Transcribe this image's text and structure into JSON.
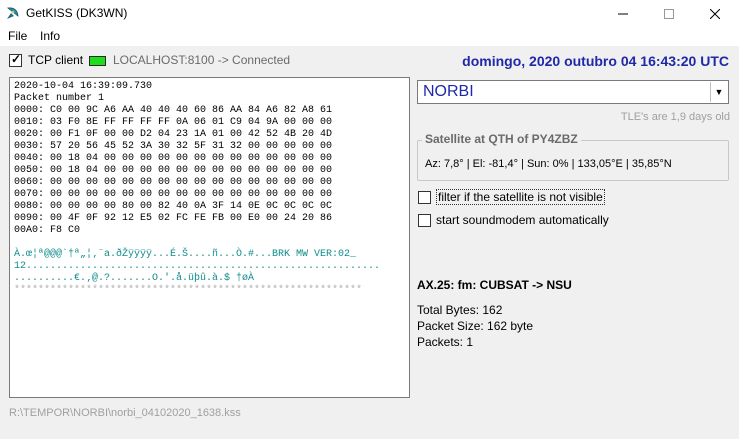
{
  "window": {
    "title": "GetKISS (DK3WN)",
    "icon": "satellite-dish-icon",
    "minimize": "—",
    "maximize": "☐",
    "close": "✕"
  },
  "menu": {
    "file": "File",
    "info": "Info"
  },
  "connection": {
    "tcp_label": "TCP client",
    "tcp_checked": true,
    "status_text": "LOCALHOST:8100 -> Connected",
    "led_color": "#1edc1e"
  },
  "datetime": "domingo, 2020 outubro 04  16:43:20 UTC",
  "hexdump": {
    "header": "2020-10-04 16:39:09.730\nPacket number 1",
    "lines": "0000: C0 00 9C A6 AA 40 40 40 60 86 AA 84 A6 82 A8 61\n0010: 03 F0 8E FF FF FF FF 0A 06 01 C9 04 9A 00 00 00\n0020: 00 F1 0F 00 00 D2 04 23 1A 01 00 42 52 4B 20 4D\n0030: 57 20 56 45 52 3A 30 32 5F 31 32 00 00 00 00 00\n0040: 00 18 04 00 00 00 00 00 00 00 00 00 00 00 00 00\n0050: 00 18 04 00 00 00 00 00 00 00 00 00 00 00 00 00\n0060: 00 00 00 00 00 00 00 00 00 00 00 00 00 00 00 00\n0070: 00 00 00 00 00 00 00 00 00 00 00 00 00 00 00 00\n0080: 00 00 00 00 80 00 82 40 0A 3F 14 0E 0C 0C 0C 0C\n0090: 00 4F 0F 92 12 E5 02 FC FE FB 00 E0 00 24 20 86\n00A0: F8 C0",
    "ascii": "À.œ¦ª@@@`†ª„¦‚¨a.ðŽÿÿÿÿ...É.Š....ñ...Ò.#...BRK MW VER:02_\n12...........................................................\n..........€.‚@.?.......O.'.å.üþû.à.$ †øÀ",
    "separator": "**********************************************************"
  },
  "satellite": {
    "selected": "NORBI",
    "dropdown_icon": "▼",
    "tle_info": "TLE's are 1,9 days old"
  },
  "qth": {
    "legend": "Satellite at QTH of PY4ZBZ",
    "info": "Az: 7,8° | El: -81,4° | Sun: 0% | 133,05°E | 35,85°N"
  },
  "options": {
    "filter_label": "filter if the satellite is not visible",
    "filter_checked": false,
    "soundmodem_label": "start soundmodem automatically",
    "soundmodem_checked": false
  },
  "packet": {
    "ax25": "AX.25: fm: CUBSAT -> NSU",
    "total_bytes": "Total Bytes: 162",
    "packet_size": "Packet Size: 162 byte",
    "packets": "Packets: 1"
  },
  "footer": {
    "filepath": "R:\\TEMPOR\\NORBI\\norbi_04102020_1638.kss"
  }
}
